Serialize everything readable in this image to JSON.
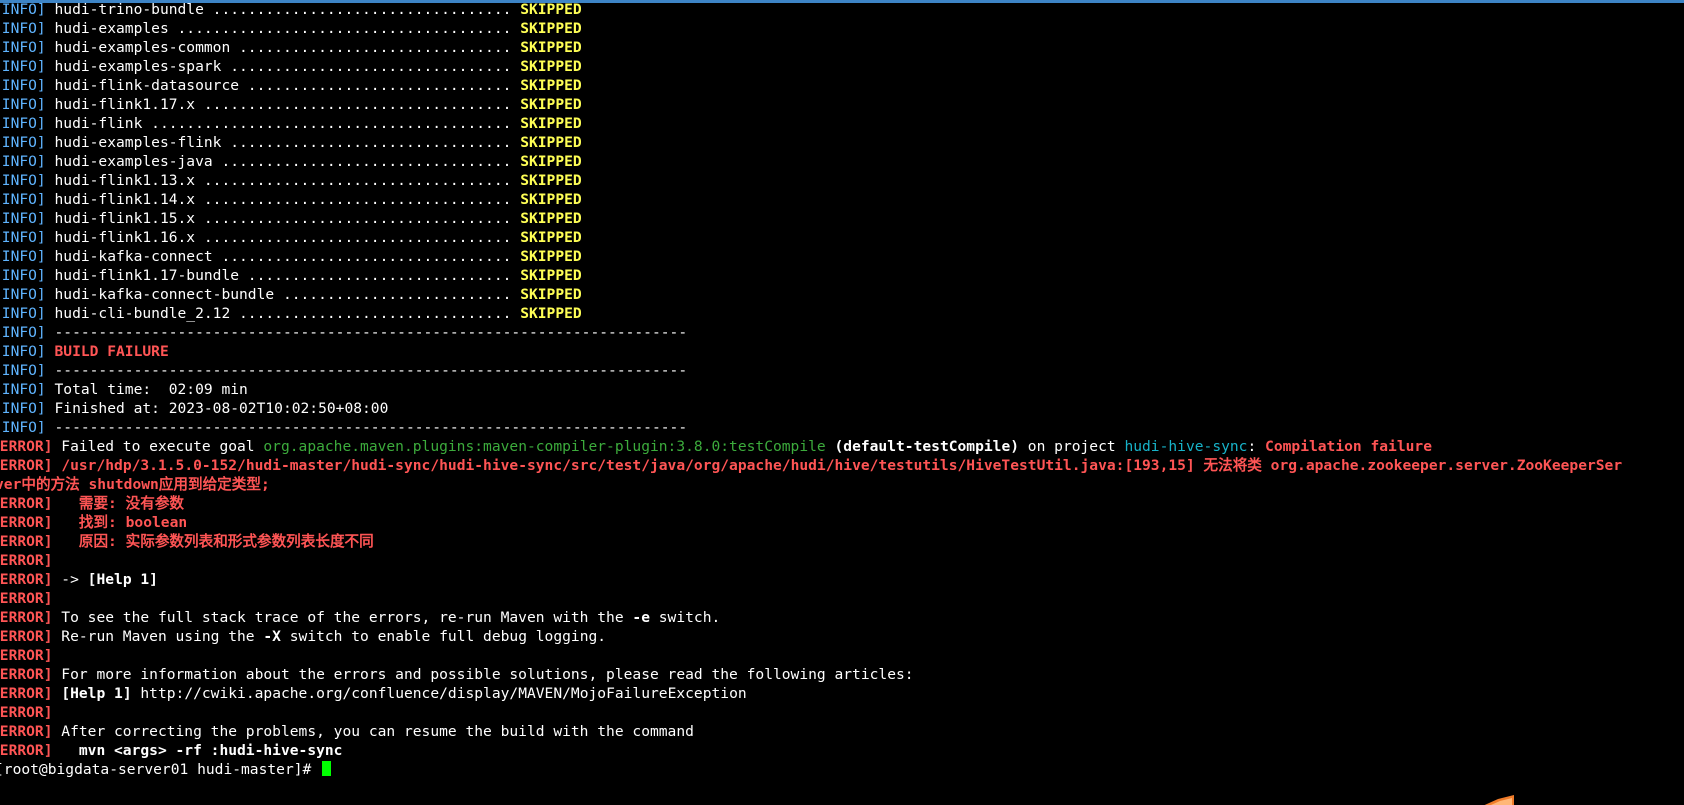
{
  "terminal": {
    "lines": [
      {
        "kind": "info",
        "parts": [
          {
            "c": "c-info",
            "t": "[INFO]"
          },
          {
            "c": "c-white",
            "t": " hudi-trino-bundle .................................. "
          },
          {
            "c": "c-yellow",
            "t": "SKIPPED"
          }
        ]
      },
      {
        "kind": "info",
        "parts": [
          {
            "c": "c-info",
            "t": "[INFO]"
          },
          {
            "c": "c-white",
            "t": " hudi-examples ...................................... "
          },
          {
            "c": "c-yellow",
            "t": "SKIPPED"
          }
        ]
      },
      {
        "kind": "info",
        "parts": [
          {
            "c": "c-info",
            "t": "[INFO]"
          },
          {
            "c": "c-white",
            "t": " hudi-examples-common ............................... "
          },
          {
            "c": "c-yellow",
            "t": "SKIPPED"
          }
        ]
      },
      {
        "kind": "info",
        "parts": [
          {
            "c": "c-info",
            "t": "[INFO]"
          },
          {
            "c": "c-white",
            "t": " hudi-examples-spark ................................ "
          },
          {
            "c": "c-yellow",
            "t": "SKIPPED"
          }
        ]
      },
      {
        "kind": "info",
        "parts": [
          {
            "c": "c-info",
            "t": "[INFO]"
          },
          {
            "c": "c-white",
            "t": " hudi-flink-datasource .............................. "
          },
          {
            "c": "c-yellow",
            "t": "SKIPPED"
          }
        ]
      },
      {
        "kind": "info",
        "parts": [
          {
            "c": "c-info",
            "t": "[INFO]"
          },
          {
            "c": "c-white",
            "t": " hudi-flink1.17.x ................................... "
          },
          {
            "c": "c-yellow",
            "t": "SKIPPED"
          }
        ]
      },
      {
        "kind": "info",
        "parts": [
          {
            "c": "c-info",
            "t": "[INFO]"
          },
          {
            "c": "c-white",
            "t": " hudi-flink ......................................... "
          },
          {
            "c": "c-yellow",
            "t": "SKIPPED"
          }
        ]
      },
      {
        "kind": "info",
        "parts": [
          {
            "c": "c-info",
            "t": "[INFO]"
          },
          {
            "c": "c-white",
            "t": " hudi-examples-flink ................................ "
          },
          {
            "c": "c-yellow",
            "t": "SKIPPED"
          }
        ]
      },
      {
        "kind": "info",
        "parts": [
          {
            "c": "c-info",
            "t": "[INFO]"
          },
          {
            "c": "c-white",
            "t": " hudi-examples-java ................................. "
          },
          {
            "c": "c-yellow",
            "t": "SKIPPED"
          }
        ]
      },
      {
        "kind": "info",
        "parts": [
          {
            "c": "c-info",
            "t": "[INFO]"
          },
          {
            "c": "c-white",
            "t": " hudi-flink1.13.x ................................... "
          },
          {
            "c": "c-yellow",
            "t": "SKIPPED"
          }
        ]
      },
      {
        "kind": "info",
        "parts": [
          {
            "c": "c-info",
            "t": "[INFO]"
          },
          {
            "c": "c-white",
            "t": " hudi-flink1.14.x ................................... "
          },
          {
            "c": "c-yellow",
            "t": "SKIPPED"
          }
        ]
      },
      {
        "kind": "info",
        "parts": [
          {
            "c": "c-info",
            "t": "[INFO]"
          },
          {
            "c": "c-white",
            "t": " hudi-flink1.15.x ................................... "
          },
          {
            "c": "c-yellow",
            "t": "SKIPPED"
          }
        ]
      },
      {
        "kind": "info",
        "parts": [
          {
            "c": "c-info",
            "t": "[INFO]"
          },
          {
            "c": "c-white",
            "t": " hudi-flink1.16.x ................................... "
          },
          {
            "c": "c-yellow",
            "t": "SKIPPED"
          }
        ]
      },
      {
        "kind": "info",
        "parts": [
          {
            "c": "c-info",
            "t": "[INFO]"
          },
          {
            "c": "c-white",
            "t": " hudi-kafka-connect ................................. "
          },
          {
            "c": "c-yellow",
            "t": "SKIPPED"
          }
        ]
      },
      {
        "kind": "info",
        "parts": [
          {
            "c": "c-info",
            "t": "[INFO]"
          },
          {
            "c": "c-white",
            "t": " hudi-flink1.17-bundle .............................. "
          },
          {
            "c": "c-yellow",
            "t": "SKIPPED"
          }
        ]
      },
      {
        "kind": "info",
        "parts": [
          {
            "c": "c-info",
            "t": "[INFO]"
          },
          {
            "c": "c-white",
            "t": " hudi-kafka-connect-bundle .......................... "
          },
          {
            "c": "c-yellow",
            "t": "SKIPPED"
          }
        ]
      },
      {
        "kind": "info",
        "parts": [
          {
            "c": "c-info",
            "t": "[INFO]"
          },
          {
            "c": "c-white",
            "t": " hudi-cli-bundle_2.12 ............................... "
          },
          {
            "c": "c-yellow",
            "t": "SKIPPED"
          }
        ]
      },
      {
        "kind": "info",
        "parts": [
          {
            "c": "c-info",
            "t": "[INFO]"
          },
          {
            "c": "c-white",
            "t": " ------------------------------------------------------------------------"
          }
        ]
      },
      {
        "kind": "info",
        "parts": [
          {
            "c": "c-info",
            "t": "[INFO]"
          },
          {
            "c": "c-white",
            "t": " "
          },
          {
            "c": "c-redb",
            "t": "BUILD FAILURE"
          }
        ]
      },
      {
        "kind": "info",
        "parts": [
          {
            "c": "c-info",
            "t": "[INFO]"
          },
          {
            "c": "c-white",
            "t": " ------------------------------------------------------------------------"
          }
        ]
      },
      {
        "kind": "info",
        "parts": [
          {
            "c": "c-info",
            "t": "[INFO]"
          },
          {
            "c": "c-white",
            "t": " Total time:  02:09 min"
          }
        ]
      },
      {
        "kind": "info",
        "parts": [
          {
            "c": "c-info",
            "t": "[INFO]"
          },
          {
            "c": "c-white",
            "t": " Finished at: 2023-08-02T10:02:50+08:00"
          }
        ]
      },
      {
        "kind": "info",
        "parts": [
          {
            "c": "c-info",
            "t": "[INFO]"
          },
          {
            "c": "c-white",
            "t": " ------------------------------------------------------------------------"
          }
        ]
      },
      {
        "kind": "err",
        "parts": [
          {
            "c": "c-redb",
            "t": "[ERROR]"
          },
          {
            "c": "c-white",
            "t": " Failed to execute goal "
          },
          {
            "c": "c-green",
            "t": "org.apache.maven.plugins:maven-compiler-plugin:3.8.0:testCompile"
          },
          {
            "c": "c-bold",
            "t": " (default-testCompile)"
          },
          {
            "c": "c-white",
            "t": " on project "
          },
          {
            "c": "c-cyan",
            "t": "hudi-hive-sync"
          },
          {
            "c": "c-white",
            "t": ": "
          },
          {
            "c": "c-redb",
            "t": "Compilation failure"
          }
        ]
      },
      {
        "kind": "err",
        "parts": [
          {
            "c": "c-redb",
            "t": "[ERROR]"
          },
          {
            "c": "c-white",
            "t": " "
          },
          {
            "c": "c-redb",
            "t": "/usr/hdp/3.1.5.0-152/hudi-master/hudi-sync/hudi-hive-sync/src/test/java/org/apache/hudi/hive/testutils/HiveTestUtil.java:[193,15] 无法将类 org.apache.zookeeper.server.ZooKeeperSer"
          }
        ]
      },
      {
        "kind": "cont",
        "parts": [
          {
            "c": "c-redb",
            "t": "ver中的方法 shutdown应用到给定类型;"
          }
        ]
      },
      {
        "kind": "err",
        "parts": [
          {
            "c": "c-redb",
            "t": "[ERROR]"
          },
          {
            "c": "c-redb",
            "t": "   需要: 没有参数"
          }
        ]
      },
      {
        "kind": "err",
        "parts": [
          {
            "c": "c-redb",
            "t": "[ERROR]"
          },
          {
            "c": "c-redb",
            "t": "   找到: boolean"
          }
        ]
      },
      {
        "kind": "err",
        "parts": [
          {
            "c": "c-redb",
            "t": "[ERROR]"
          },
          {
            "c": "c-redb",
            "t": "   原因: 实际参数列表和形式参数列表长度不同"
          }
        ]
      },
      {
        "kind": "err",
        "parts": [
          {
            "c": "c-redb",
            "t": "[ERROR]"
          }
        ]
      },
      {
        "kind": "err",
        "parts": [
          {
            "c": "c-redb",
            "t": "[ERROR]"
          },
          {
            "c": "c-white",
            "t": " -> "
          },
          {
            "c": "c-bold",
            "t": "[Help 1]"
          }
        ]
      },
      {
        "kind": "err",
        "parts": [
          {
            "c": "c-redb",
            "t": "[ERROR]"
          }
        ]
      },
      {
        "kind": "err",
        "parts": [
          {
            "c": "c-redb",
            "t": "[ERROR]"
          },
          {
            "c": "c-white",
            "t": " To see the full stack trace of the errors, re-run Maven with the "
          },
          {
            "c": "c-bold",
            "t": "-e"
          },
          {
            "c": "c-white",
            "t": " switch."
          }
        ]
      },
      {
        "kind": "err",
        "parts": [
          {
            "c": "c-redb",
            "t": "[ERROR]"
          },
          {
            "c": "c-white",
            "t": " Re-run Maven using the "
          },
          {
            "c": "c-bold",
            "t": "-X"
          },
          {
            "c": "c-white",
            "t": " switch to enable full debug logging."
          }
        ]
      },
      {
        "kind": "err",
        "parts": [
          {
            "c": "c-redb",
            "t": "[ERROR]"
          }
        ]
      },
      {
        "kind": "err",
        "parts": [
          {
            "c": "c-redb",
            "t": "[ERROR]"
          },
          {
            "c": "c-white",
            "t": " For more information about the errors and possible solutions, please read the following articles:"
          }
        ]
      },
      {
        "kind": "err",
        "parts": [
          {
            "c": "c-redb",
            "t": "[ERROR]"
          },
          {
            "c": "c-white",
            "t": " "
          },
          {
            "c": "c-bold",
            "t": "[Help 1]"
          },
          {
            "c": "c-white",
            "t": " http://cwiki.apache.org/confluence/display/MAVEN/MojoFailureException"
          }
        ]
      },
      {
        "kind": "err",
        "parts": [
          {
            "c": "c-redb",
            "t": "[ERROR]"
          }
        ]
      },
      {
        "kind": "err",
        "parts": [
          {
            "c": "c-redb",
            "t": "[ERROR]"
          },
          {
            "c": "c-white",
            "t": " After correcting the problems, you can resume the build with the command"
          }
        ]
      },
      {
        "kind": "err",
        "parts": [
          {
            "c": "c-redb",
            "t": "[ERROR]"
          },
          {
            "c": "c-bold",
            "t": "   mvn <args> -rf :hudi-hive-sync"
          }
        ]
      },
      {
        "kind": "prompt",
        "parts": [
          {
            "c": "c-white",
            "t": "[root@bigdata-server01 hudi-master]# "
          }
        ]
      }
    ]
  },
  "colors": {
    "background": "#000000",
    "info": "#5fb4ff",
    "skipped": "#ffff55",
    "error": "#ff5555",
    "plugin": "#3cab3c",
    "project": "#17b3c9",
    "cursor": "#00ff00"
  },
  "icons": {
    "cursor": "block-cursor",
    "corner": "pen-tip-icon"
  }
}
